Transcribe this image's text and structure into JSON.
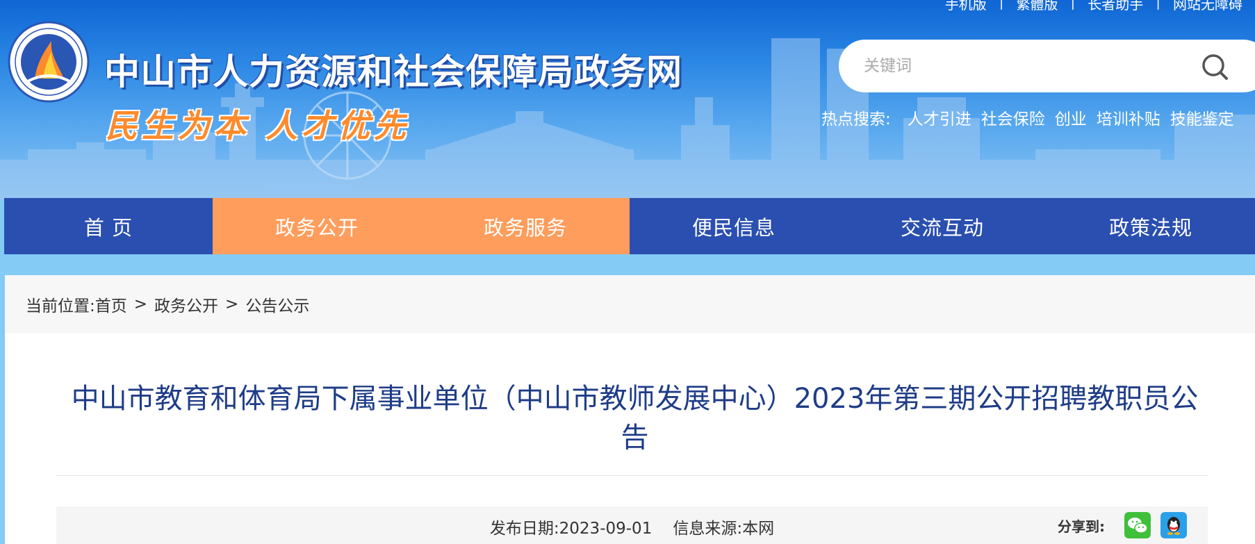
{
  "header": {
    "top_links": [
      "手机版",
      "繁體版",
      "长者助手",
      "网站无障碍"
    ],
    "site_title": "中山市人力资源和社会保障局政务网",
    "slogan": "民生为本 人才优先",
    "search": {
      "placeholder": "关键词",
      "value": ""
    },
    "hot_search": {
      "label": "热点搜索:",
      "items": [
        "人才引进",
        "社会保险",
        "创业",
        "培训补贴",
        "技能鉴定"
      ]
    }
  },
  "nav": {
    "items": [
      {
        "label": "首 页"
      },
      {
        "label": "政务公开"
      },
      {
        "label": "政务服务"
      },
      {
        "label": "便民信息"
      },
      {
        "label": "交流互动"
      },
      {
        "label": "政策法规"
      }
    ]
  },
  "breadcrumb": {
    "prefix": "当前位置:",
    "items": [
      "首页",
      "政务公开",
      "公告公示"
    ],
    "separator": ">"
  },
  "article": {
    "title": "中山市教育和体育局下属事业单位（中山市教师发展中心）2023年第三期公开招聘教职员公告",
    "publish_date_label": "发布日期:",
    "publish_date": "2023-09-01",
    "source_label": "信息来源:",
    "source": "本网",
    "share_label": "分享到:"
  },
  "colors": {
    "nav_bg": "#2a4fb0",
    "nav_active": "#ff9d5c",
    "title_color": "#1e3c87",
    "slogan_color": "#ff8a2b"
  },
  "icons": [
    "logo-emblem",
    "search-icon",
    "wechat-icon",
    "qq-icon"
  ]
}
